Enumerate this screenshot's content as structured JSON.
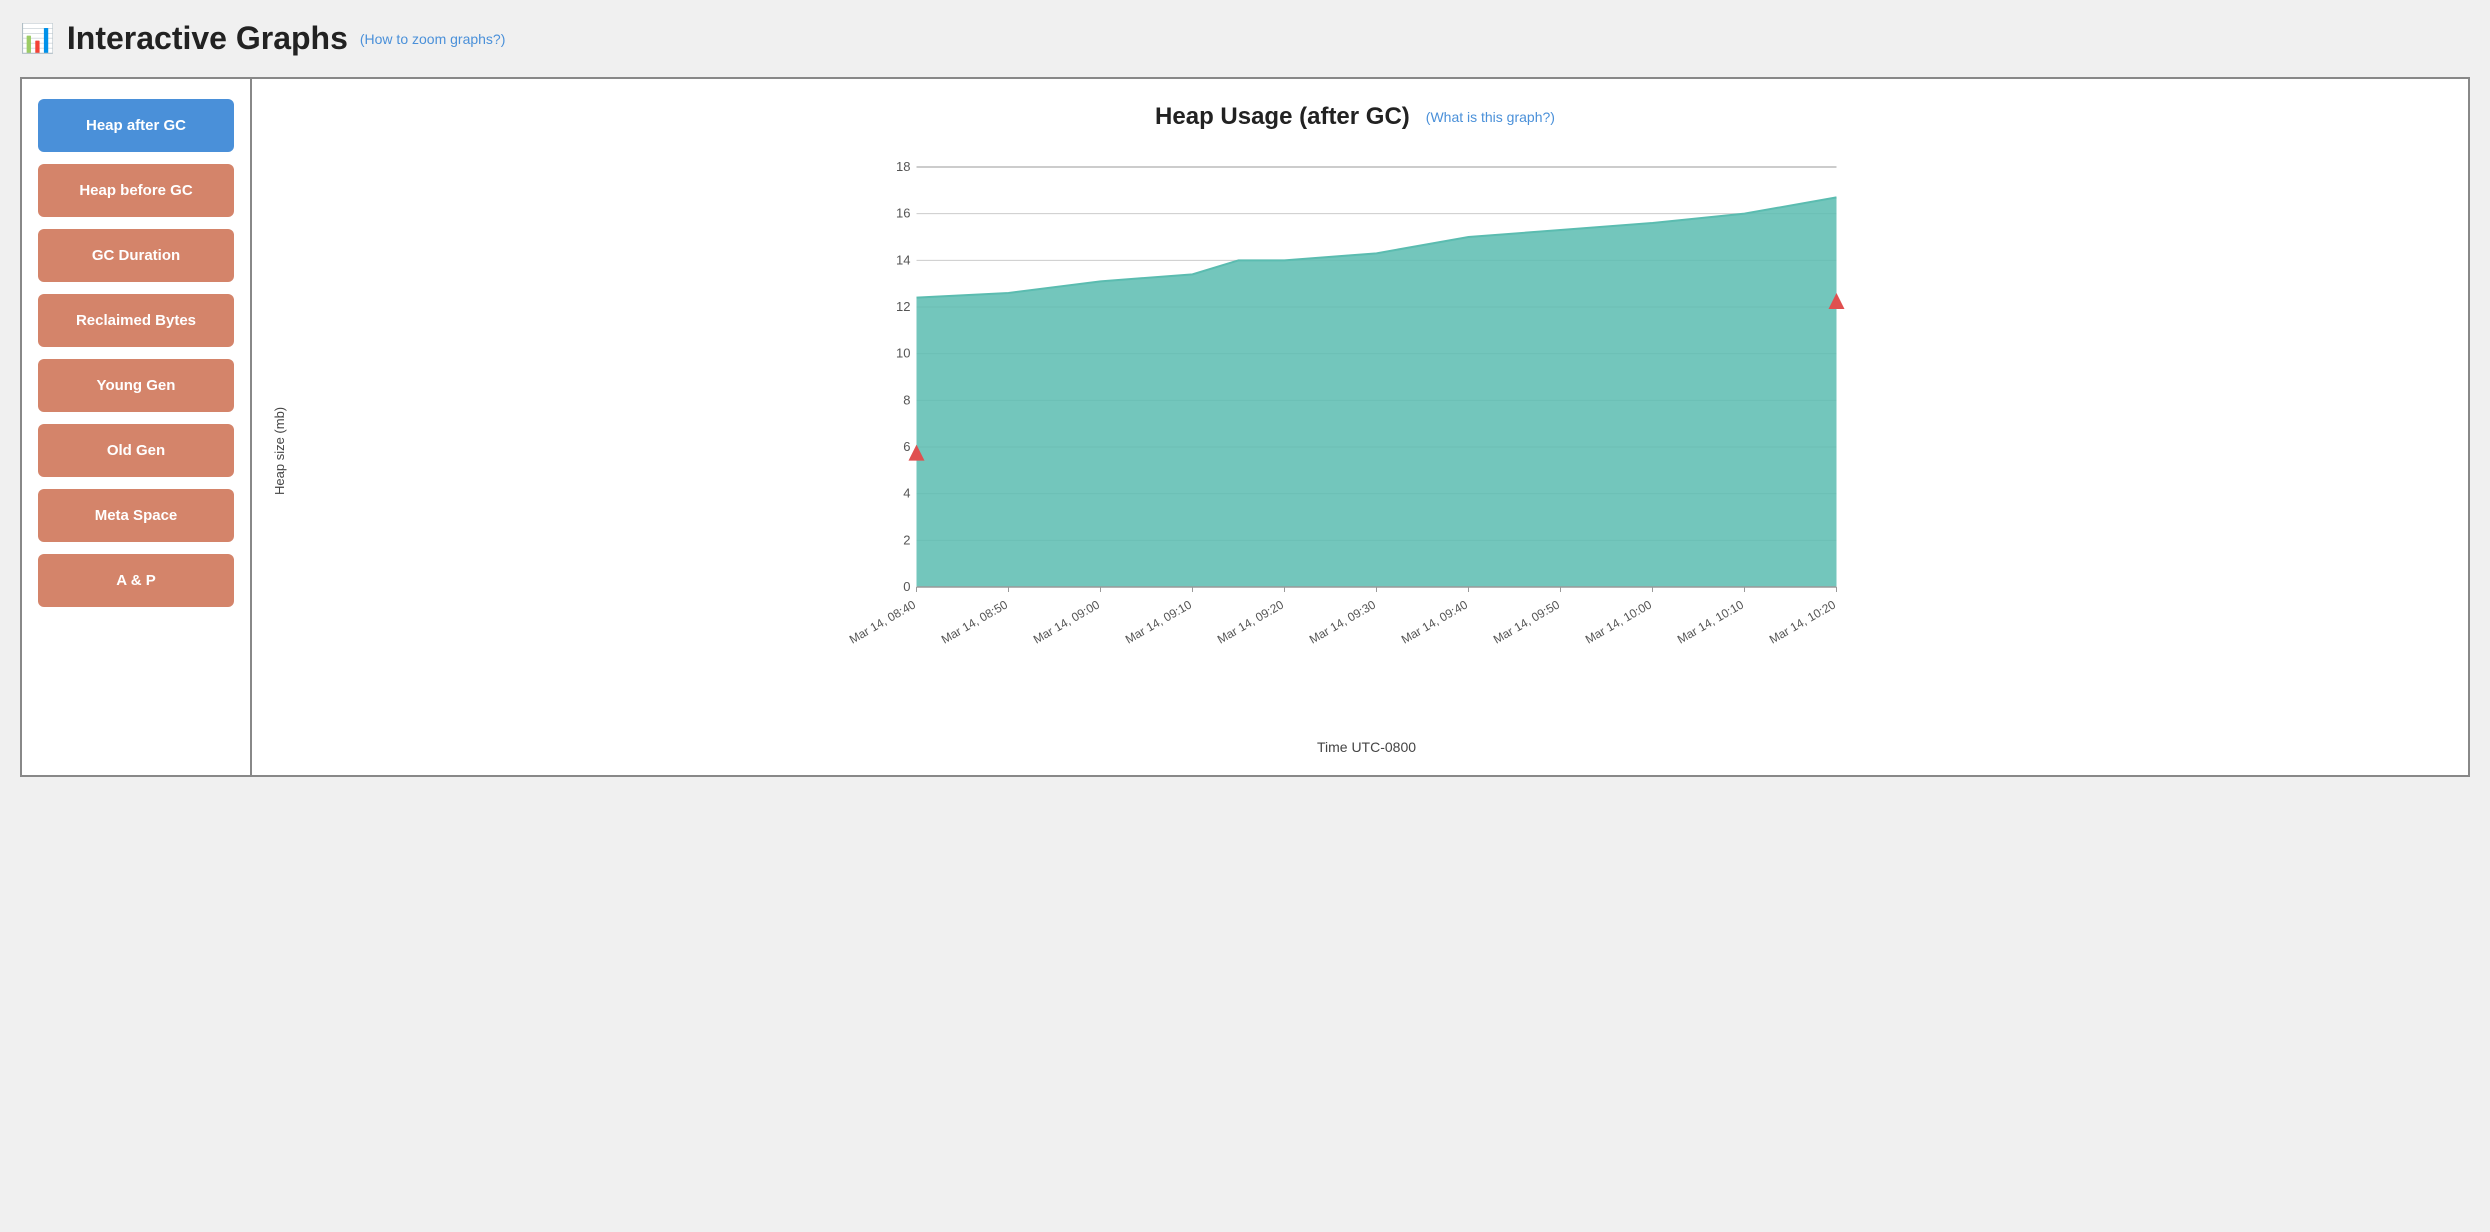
{
  "header": {
    "title": "Interactive Graphs",
    "zoom_link_text": "(How to zoom graphs?)"
  },
  "sidebar": {
    "items": [
      {
        "id": "heap-after-gc",
        "label": "Heap after GC",
        "active": true
      },
      {
        "id": "heap-before-gc",
        "label": "Heap before GC",
        "active": false
      },
      {
        "id": "gc-duration",
        "label": "GC Duration",
        "active": false
      },
      {
        "id": "reclaimed-bytes",
        "label": "Reclaimed Bytes",
        "active": false
      },
      {
        "id": "young-gen",
        "label": "Young Gen",
        "active": false
      },
      {
        "id": "old-gen",
        "label": "Old Gen",
        "active": false
      },
      {
        "id": "meta-space",
        "label": "Meta Space",
        "active": false
      },
      {
        "id": "a-and-p",
        "label": "A & P",
        "active": false
      }
    ]
  },
  "chart": {
    "title": "Heap Usage (after GC)",
    "what_link_text": "(What is this graph?)",
    "y_axis_label": "Heap size (mb)",
    "x_axis_label": "Time UTC-0800",
    "y_ticks": [
      0,
      2,
      4,
      6,
      8,
      10,
      12,
      14,
      16,
      18
    ],
    "x_ticks": [
      "Mar 14, 08:40",
      "Mar 14, 08:50",
      "Mar 14, 09:00",
      "Mar 14, 09:10",
      "Mar 14, 09:20",
      "Mar 14, 09:30",
      "Mar 14, 09:40",
      "Mar 14, 09:50",
      "Mar 14, 10:00",
      "Mar 14, 10:10",
      "Mar 14, 10:20"
    ],
    "colors": {
      "area_fill": "#5bbcb0",
      "area_stroke": "#5bbcb0",
      "grid_line": "#ccc",
      "spike": "#e05050",
      "background": "#fff"
    }
  }
}
